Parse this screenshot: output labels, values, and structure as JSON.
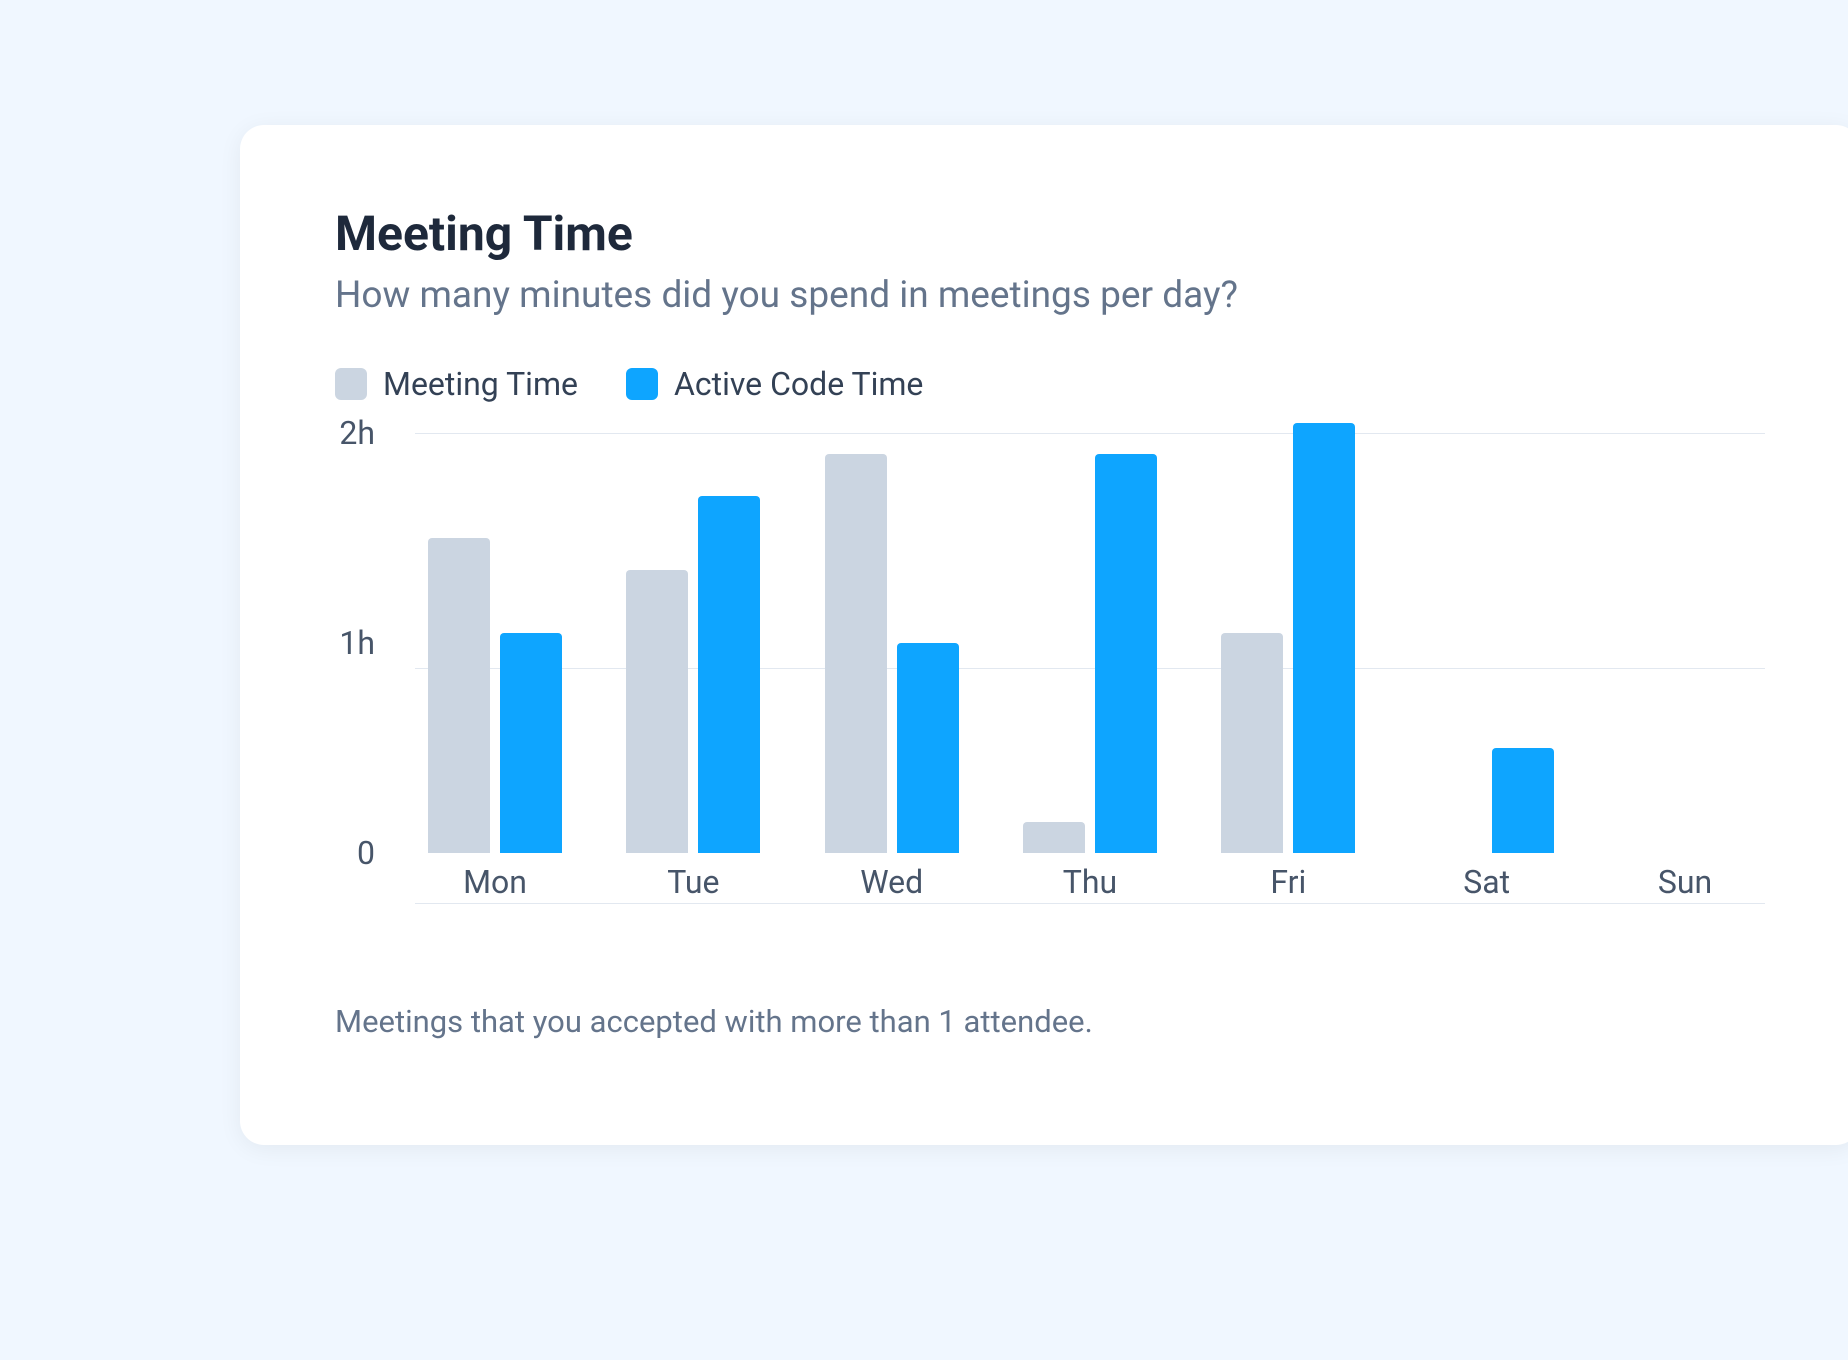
{
  "card": {
    "title": "Meeting Time",
    "subtitle": "How many minutes did you spend in meetings per day?",
    "footnote": "Meetings that you accepted with more than 1 attendee."
  },
  "legend": {
    "meeting_time": "Meeting Time",
    "active_code_time": "Active Code Time"
  },
  "chart_data": {
    "type": "bar",
    "title": "Meeting Time",
    "xlabel": "",
    "ylabel": "",
    "categories": [
      "Mon",
      "Tue",
      "Wed",
      "Thu",
      "Fri",
      "Sat",
      "Sun"
    ],
    "y_ticks": [
      "0",
      "1h",
      "2h"
    ],
    "ylim": [
      0,
      2
    ],
    "series": [
      {
        "name": "Meeting Time",
        "color": "#cbd5e1",
        "values": [
          1.5,
          1.35,
          1.9,
          0.15,
          1.05,
          0,
          0
        ]
      },
      {
        "name": "Active Code Time",
        "color": "#0ea5ff",
        "values": [
          1.05,
          1.7,
          1.0,
          1.9,
          2.05,
          0.5,
          0
        ]
      }
    ]
  }
}
